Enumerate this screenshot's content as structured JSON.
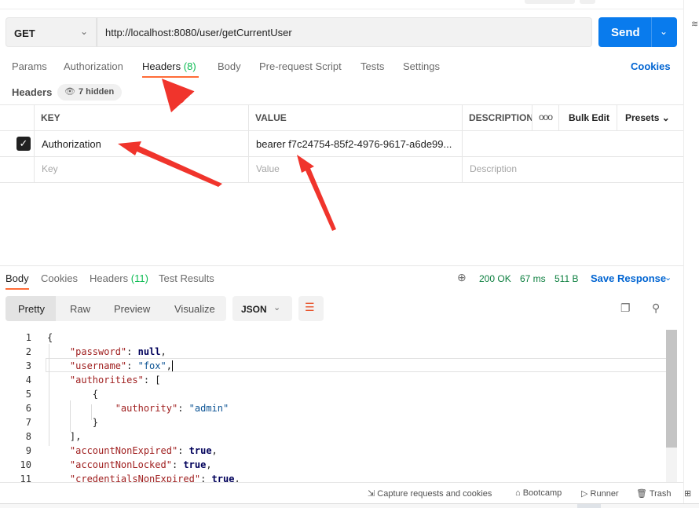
{
  "request": {
    "method": "GET",
    "url": "http://localhost:8080/user/getCurrentUser",
    "send_label": "Send"
  },
  "request_tabs": {
    "params": "Params",
    "authorization": "Authorization",
    "headers": "Headers",
    "headers_count": "(8)",
    "body": "Body",
    "prerequest": "Pre-request Script",
    "tests": "Tests",
    "settings": "Settings",
    "cookies": "Cookies"
  },
  "headers_section": {
    "title": "Headers",
    "hidden_label": "7 hidden",
    "columns": {
      "key": "KEY",
      "value": "VALUE",
      "description": "DESCRIPTION",
      "bulk_edit": "Bulk Edit",
      "presets": "Presets"
    },
    "row": {
      "checked": true,
      "key": "Authorization",
      "value": "bearer f7c24754-85f2-4976-9617-a6de99..."
    },
    "placeholders": {
      "key": "Key",
      "value": "Value",
      "description": "Description"
    }
  },
  "response": {
    "tabs": {
      "body": "Body",
      "cookies": "Cookies",
      "headers": "Headers",
      "headers_count": "(11)",
      "test_results": "Test Results"
    },
    "status": "200 OK",
    "time": "67 ms",
    "size": "511 B",
    "save_label": "Save Response",
    "formats": {
      "pretty": "Pretty",
      "raw": "Raw",
      "preview": "Preview",
      "visualize": "Visualize"
    },
    "language": "JSON"
  },
  "code": {
    "line_numbers": [
      "1",
      "2",
      "3",
      "4",
      "5",
      "6",
      "7",
      "8",
      "9",
      "10",
      "11"
    ],
    "l1": "{",
    "l2_key": "\"password\"",
    "l2_val": "null",
    "l3_key": "\"username\"",
    "l3_val": "\"fox\"",
    "l4_key": "\"authorities\"",
    "l4_val": "[",
    "l5": "{",
    "l6_key": "\"authority\"",
    "l6_val": "\"admin\"",
    "l7": "}",
    "l8": "],",
    "l9_key": "\"accountNonExpired\"",
    "l9_val": "true",
    "l10_key": "\"accountNonLocked\"",
    "l10_val": "true",
    "l11_key": "\"credentialsNonExpired\"",
    "l11_val": "true"
  },
  "footer": {
    "capture": "Capture requests and cookies",
    "bootcamp": "Bootcamp",
    "runner": "Runner",
    "trash": "Trash"
  },
  "colors": {
    "accent_orange": "#ff6c37",
    "send_blue": "#097bed",
    "link_blue": "#0265d2",
    "status_green": "#0b7e3e",
    "annotation_red": "#f0342c"
  },
  "icons": [
    "chevron-down-icon",
    "eye-icon",
    "more-dots-icon",
    "checkbox-icon",
    "globe-icon",
    "wrap-lines-icon",
    "copy-icon",
    "search-icon",
    "capture-icon",
    "bootcamp-icon",
    "runner-icon",
    "trash-icon",
    "layout-icon"
  ]
}
